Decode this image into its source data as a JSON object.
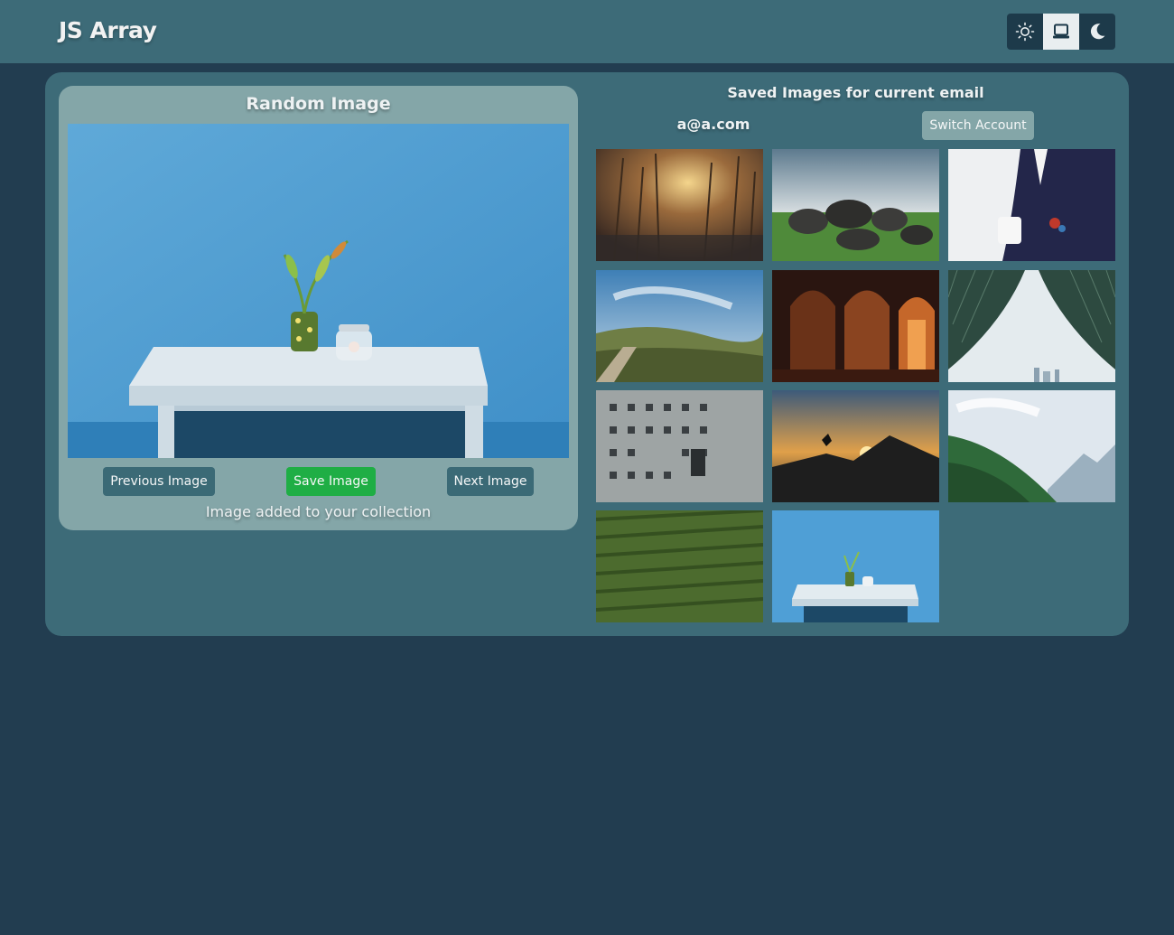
{
  "app": {
    "title": "JS Array"
  },
  "theme": {
    "options": [
      {
        "name": "light",
        "icon": "sun-icon"
      },
      {
        "name": "system",
        "icon": "laptop-icon",
        "selected": true
      },
      {
        "name": "dark",
        "icon": "moon-icon"
      }
    ]
  },
  "random_panel": {
    "title": "Random Image",
    "previous_label": "Previous Image",
    "save_label": "Save Image",
    "next_label": "Next Image",
    "status": "Image added to your collection"
  },
  "saved_panel": {
    "title": "Saved Images for current email",
    "email": "a@a.com",
    "switch_label": "Switch Account",
    "image_count": 11
  },
  "colors": {
    "page_bg": "#223d50",
    "card_bg": "#3d6b78",
    "panel_bg": "#84a6a8",
    "save_button": "#1fae45",
    "nav_button": "#3b6a76"
  }
}
